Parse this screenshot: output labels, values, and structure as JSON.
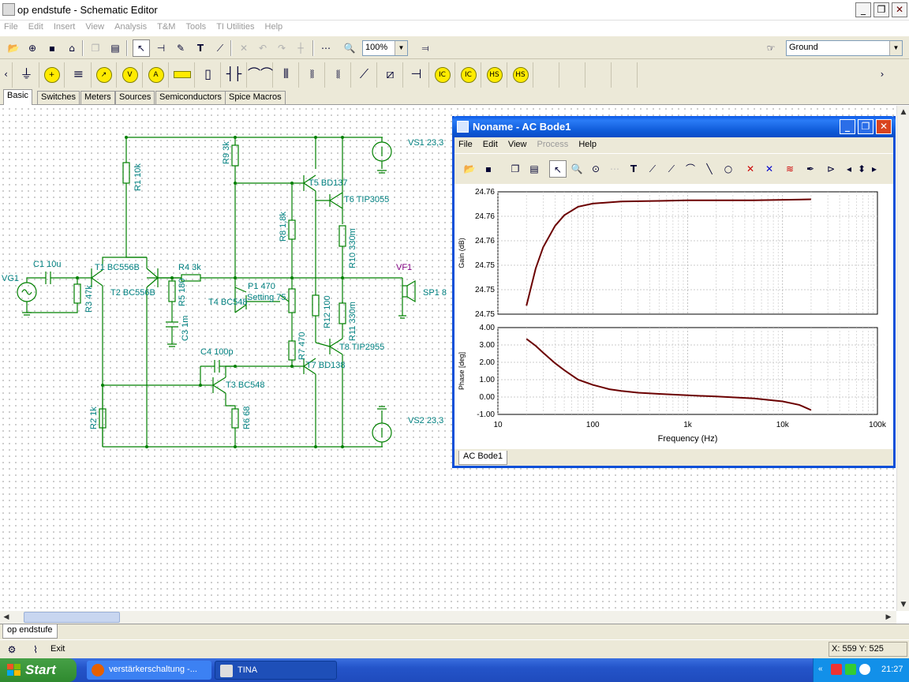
{
  "window": {
    "title": "op endstufe - Schematic Editor",
    "min": "_",
    "max": "❐",
    "close": "✕"
  },
  "menu": [
    "File",
    "Edit",
    "Insert",
    "View",
    "Analysis",
    "T&M",
    "Tools",
    "TI Utilities",
    "Help"
  ],
  "toolbar": {
    "zoom": "100%",
    "ground_select": "Ground"
  },
  "tabs": [
    "Basic",
    "Switches",
    "Meters",
    "Sources",
    "Semiconductors",
    "Spice Macros"
  ],
  "schematic": {
    "labels": {
      "vs1": "VS1 23,3",
      "vs2": "VS2 23,3",
      "vg1": "VG1",
      "c1": "C1 10u",
      "t1": "T1 BC556B",
      "t2": "T2 BC556B",
      "r4": "R4 3k",
      "r1": "R1 10k",
      "r9": "R9 3k",
      "r3": "R3 47k",
      "r5": "R5 180",
      "c3": "C3 1m",
      "t4": "T4 BC548",
      "p1": "P1 470",
      "setting": "Setting 75",
      "t5": "T5 BD137",
      "t6": "T6 TIP3055",
      "r8": "R8 1,8k",
      "r10": "R10 330m",
      "vf1": "VF1",
      "sp1": "SP1 8",
      "r12": "R12 100",
      "r11": "R11 330m",
      "r7": "R7 470",
      "t8": "T8 TIP2955",
      "t7": "T7 BD138",
      "c4": "C4 100p",
      "t3": "T3 BC548",
      "r2": "R2 1k",
      "r6": "R6 68"
    }
  },
  "bode": {
    "title": "Noname - AC Bode1",
    "menu": [
      "File",
      "Edit",
      "View",
      "Process",
      "Help"
    ],
    "tab": "AC Bode1",
    "gain_axis_label": "Gain (dB)",
    "phase_axis_label": "Phase [deg]",
    "x_axis_label": "Frequency (Hz)"
  },
  "chart_data": [
    {
      "type": "line",
      "ylabel": "Gain (dB)",
      "xlabel": "",
      "xscale": "log",
      "xlim": [
        10,
        100000
      ],
      "yticks": [
        "24.76",
        "24.76",
        "24.76",
        "24.75",
        "24.75",
        "24.75"
      ],
      "series": [
        {
          "x": [
            20,
            25,
            30,
            40,
            50,
            70,
            100,
            200,
            500,
            1000,
            5000,
            20000
          ],
          "y": [
            0,
            0.35,
            0.55,
            0.75,
            0.85,
            0.93,
            0.96,
            0.98,
            0.985,
            0.99,
            0.99,
            1.0
          ]
        }
      ],
      "y_note_units": "relative 0-1 (tick labels printed with same rounded values)"
    },
    {
      "type": "line",
      "ylabel": "Phase [deg]",
      "xlabel": "Frequency (Hz)",
      "xscale": "log",
      "xlim": [
        10,
        100000
      ],
      "ylim": [
        -1,
        4
      ],
      "yticks": [
        "4.00",
        "3.00",
        "2.00",
        "1.00",
        "0.00",
        "-1.00"
      ],
      "xticks": [
        "10",
        "100",
        "1k",
        "10k",
        "100k"
      ],
      "series": [
        {
          "x": [
            20,
            25,
            30,
            40,
            50,
            70,
            100,
            150,
            200,
            300,
            500,
            1000,
            2000,
            5000,
            10000,
            15000,
            20000
          ],
          "y": [
            3.35,
            2.95,
            2.55,
            1.95,
            1.55,
            1.0,
            0.7,
            0.45,
            0.35,
            0.25,
            0.18,
            0.1,
            0.03,
            -0.08,
            -0.25,
            -0.45,
            -0.75
          ]
        }
      ]
    }
  ],
  "doc_tab": "op endstufe",
  "status": {
    "coords": "X: 559  Y: 525",
    "exit": "Exit"
  },
  "taskbar": {
    "start": "Start",
    "tasks": [
      "verstärkerschaltung -...",
      "TINA"
    ],
    "clock": "21:27"
  },
  "colors": {
    "title_blue": "#0a4fd8",
    "schematic_wire": "#008080",
    "component": "#008000",
    "plot_line": "#6b0000",
    "taskbar": "#2454c9"
  }
}
